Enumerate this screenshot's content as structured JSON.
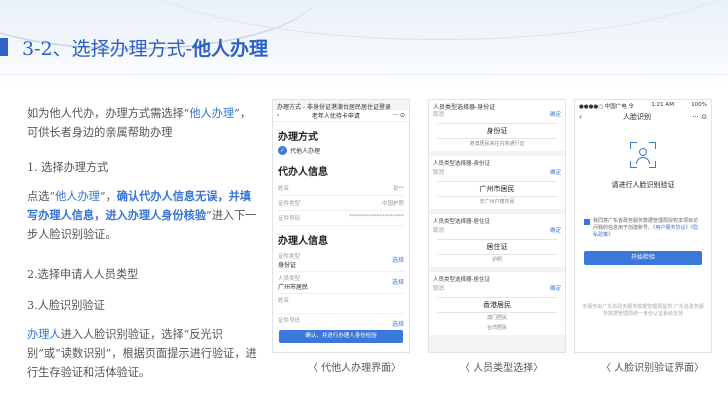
{
  "title": {
    "main": "3-2、选择办理方式-",
    "strong": "他人办理"
  },
  "left": {
    "intro": [
      "如为他人代办，办理方式需选择“",
      "他人办理",
      "”，可供长者身边的亲属帮助办理"
    ],
    "step1": "1.  选择办理方式",
    "step1_detail": [
      "点选“",
      "他人办理",
      "”，",
      "确认代办人信息无误，并填写办理人信息，进入办理人身份核验",
      "”进入下一步人脸识别验证。"
    ],
    "step2": "2.选择申请人人员类型",
    "step3": "3.人脸识别验证",
    "step3_detail": [
      "办理人",
      "进入人脸识别验证，选择“反光识别”或“读数识别”，根据页面提示进行验证，进行生存验证和活体验证。"
    ]
  },
  "screen1": {
    "topbar": "办理方式 - 非身份证港澳台居民居住证登录",
    "nav_title": "老年人优待卡申请",
    "section1": "办理方式",
    "option": "代他人办理",
    "section2": "代办人信息",
    "agent_rows": [
      {
        "k": "姓名",
        "v": "张**"
      },
      {
        "k": "证件类型",
        "v": "中国护照"
      },
      {
        "k": "证件号码",
        "v": "********************"
      }
    ],
    "section3": "办理人信息",
    "handler_rows": [
      {
        "k": "证件类型",
        "v": "身份证",
        "link": "选择"
      },
      {
        "k": "人员类型",
        "v": "广州市居民",
        "link": "选择"
      },
      {
        "k": "姓名",
        "v": "",
        "link": ""
      },
      {
        "k": "证件号码",
        "v": "",
        "link": "选择"
      }
    ],
    "button": "确认，并进行办理人身份检验"
  },
  "screen2": {
    "topbar": "人员类型选择器-身份证",
    "groups": [
      {
        "h": "",
        "y": "",
        "l": "取消",
        "ly": "确定",
        "opt": "身份证",
        "sub": [
          "港澳居民来往内地通行证"
        ]
      },
      {
        "h": "人员类型选择器-身份证",
        "y": "",
        "l": "取消",
        "ly": "确定",
        "opt": "广州市居民",
        "sub": [
          "非广州户籍市民"
        ]
      },
      {
        "h": "人员类型选择器-居住证",
        "y": "",
        "l": "取消",
        "ly": "确定",
        "opt": "居住证",
        "sub": [
          "护照"
        ]
      },
      {
        "h": "人员类型选择器-居住证",
        "y": "",
        "l": "取消",
        "ly": "确定",
        "opt": "香港居民",
        "sub": [
          "澳门居民",
          "台湾居民"
        ]
      }
    ]
  },
  "screen3": {
    "status_left": "●●●●○ 中国广电 令",
    "status_center": "1:21 AM",
    "status_right": "100%",
    "nav_title": "人脸识别",
    "prompt": "请进行人脸识别验证",
    "agree_text": "我同意广东省政务服务数据管理局授权本项目访问我的信息用于创建账号。",
    "agree_links": "《用户服务协议》《隐私政策》",
    "button": "开始检验",
    "footer": "本服务由广东省政务服务数据管理局提供 广东省政务服务数据管理局统一身份认证系统支持"
  },
  "captions": [
    "〈 代他人办理界面〉",
    "〈 人员类型选择〉",
    "〈 人脸识别验证界面〉"
  ],
  "colors": {
    "accent": "#2f62c7",
    "link": "#3574d8",
    "button": "#3a78d9"
  }
}
